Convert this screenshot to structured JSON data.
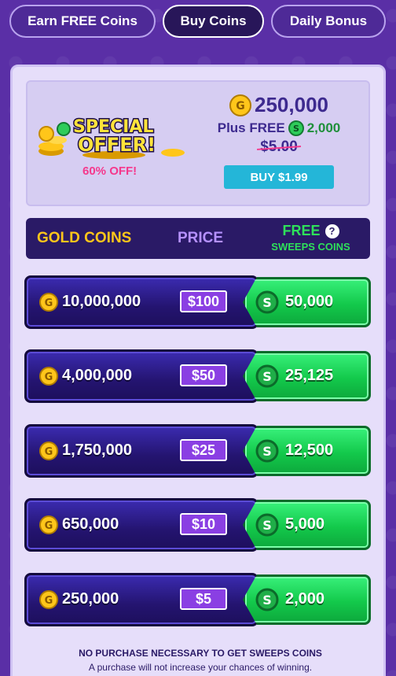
{
  "tabs": [
    {
      "label": "Earn FREE Coins",
      "active": false
    },
    {
      "label": "Buy Coins",
      "active": true
    },
    {
      "label": "Daily Bonus",
      "active": false
    }
  ],
  "special_offer": {
    "art_text_1": "SPECIAL",
    "art_text_2": "OFFER!",
    "discount": "60% OFF!",
    "gold_amount": "250,000",
    "plus_label": "Plus FREE",
    "sweeps_amount": "2,000",
    "old_price": "$5.00",
    "buy_label": "BUY $1.99"
  },
  "table_header": {
    "gold_coins": "GOLD COINS",
    "price": "PRICE",
    "free": "FREE",
    "sweeps_coins": "SWEEPS COINS",
    "help_symbol": "?"
  },
  "packages": [
    {
      "gold": "10,000,000",
      "price": "$100",
      "sweeps": "50,000"
    },
    {
      "gold": "4,000,000",
      "price": "$50",
      "sweeps": "25,125"
    },
    {
      "gold": "1,750,000",
      "price": "$25",
      "sweeps": "12,500"
    },
    {
      "gold": "650,000",
      "price": "$10",
      "sweeps": "5,000"
    },
    {
      "gold": "250,000",
      "price": "$5",
      "sweeps": "2,000"
    }
  ],
  "footer": {
    "line1": "NO PURCHASE NECESSARY TO GET SWEEPS COINS",
    "line2": "A purchase will not increase your chances of winning."
  },
  "colors": {
    "gold": "#ffc61a",
    "sweeps_green": "#2ee05a",
    "price_purple": "#8a3fe3",
    "accent_pink": "#f5388c",
    "buy_cyan": "#24b6d8"
  }
}
